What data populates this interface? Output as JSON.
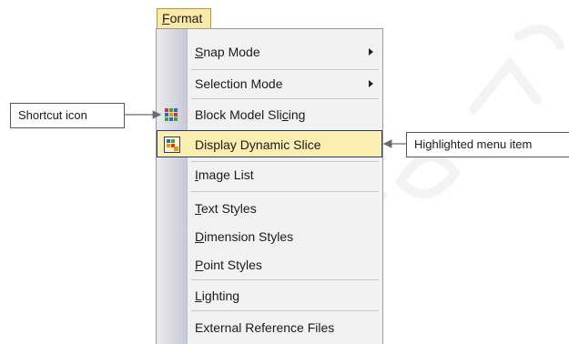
{
  "menu": {
    "title_first": "F",
    "title_rest": "ormat",
    "items": [
      {
        "prefix": "",
        "accel": "S",
        "rest": "nap Mode",
        "submenu": true
      },
      {
        "prefix": "",
        "accel": "",
        "rest": "Selection Mode",
        "submenu": true
      },
      {
        "prefix": "Block Model Sli",
        "accel": "c",
        "rest": "ing",
        "icon": "block-model-slicing-icon"
      },
      {
        "prefix": "",
        "accel": "",
        "rest": "Display Dynamic Slice",
        "icon": "display-dynamic-slice-icon",
        "highlighted": true
      },
      {
        "prefix": "",
        "accel": "I",
        "rest": "mage List"
      },
      {
        "prefix": "",
        "accel": "T",
        "rest": "ext Styles"
      },
      {
        "prefix": "",
        "accel": "D",
        "rest": "imension Styles"
      },
      {
        "prefix": "",
        "accel": "P",
        "rest": "oint Styles"
      },
      {
        "prefix": "",
        "accel": "L",
        "rest": "ighting"
      },
      {
        "prefix": "",
        "accel": "",
        "rest": "External Reference Files"
      }
    ]
  },
  "callouts": {
    "shortcut": "Shortcut icon",
    "highlighted": "Highlighted menu item"
  },
  "colors": {
    "highlight_fill": "#fbeeb0",
    "highlight_border": "#243a7a",
    "tab_fill": "#fbe9a8"
  }
}
